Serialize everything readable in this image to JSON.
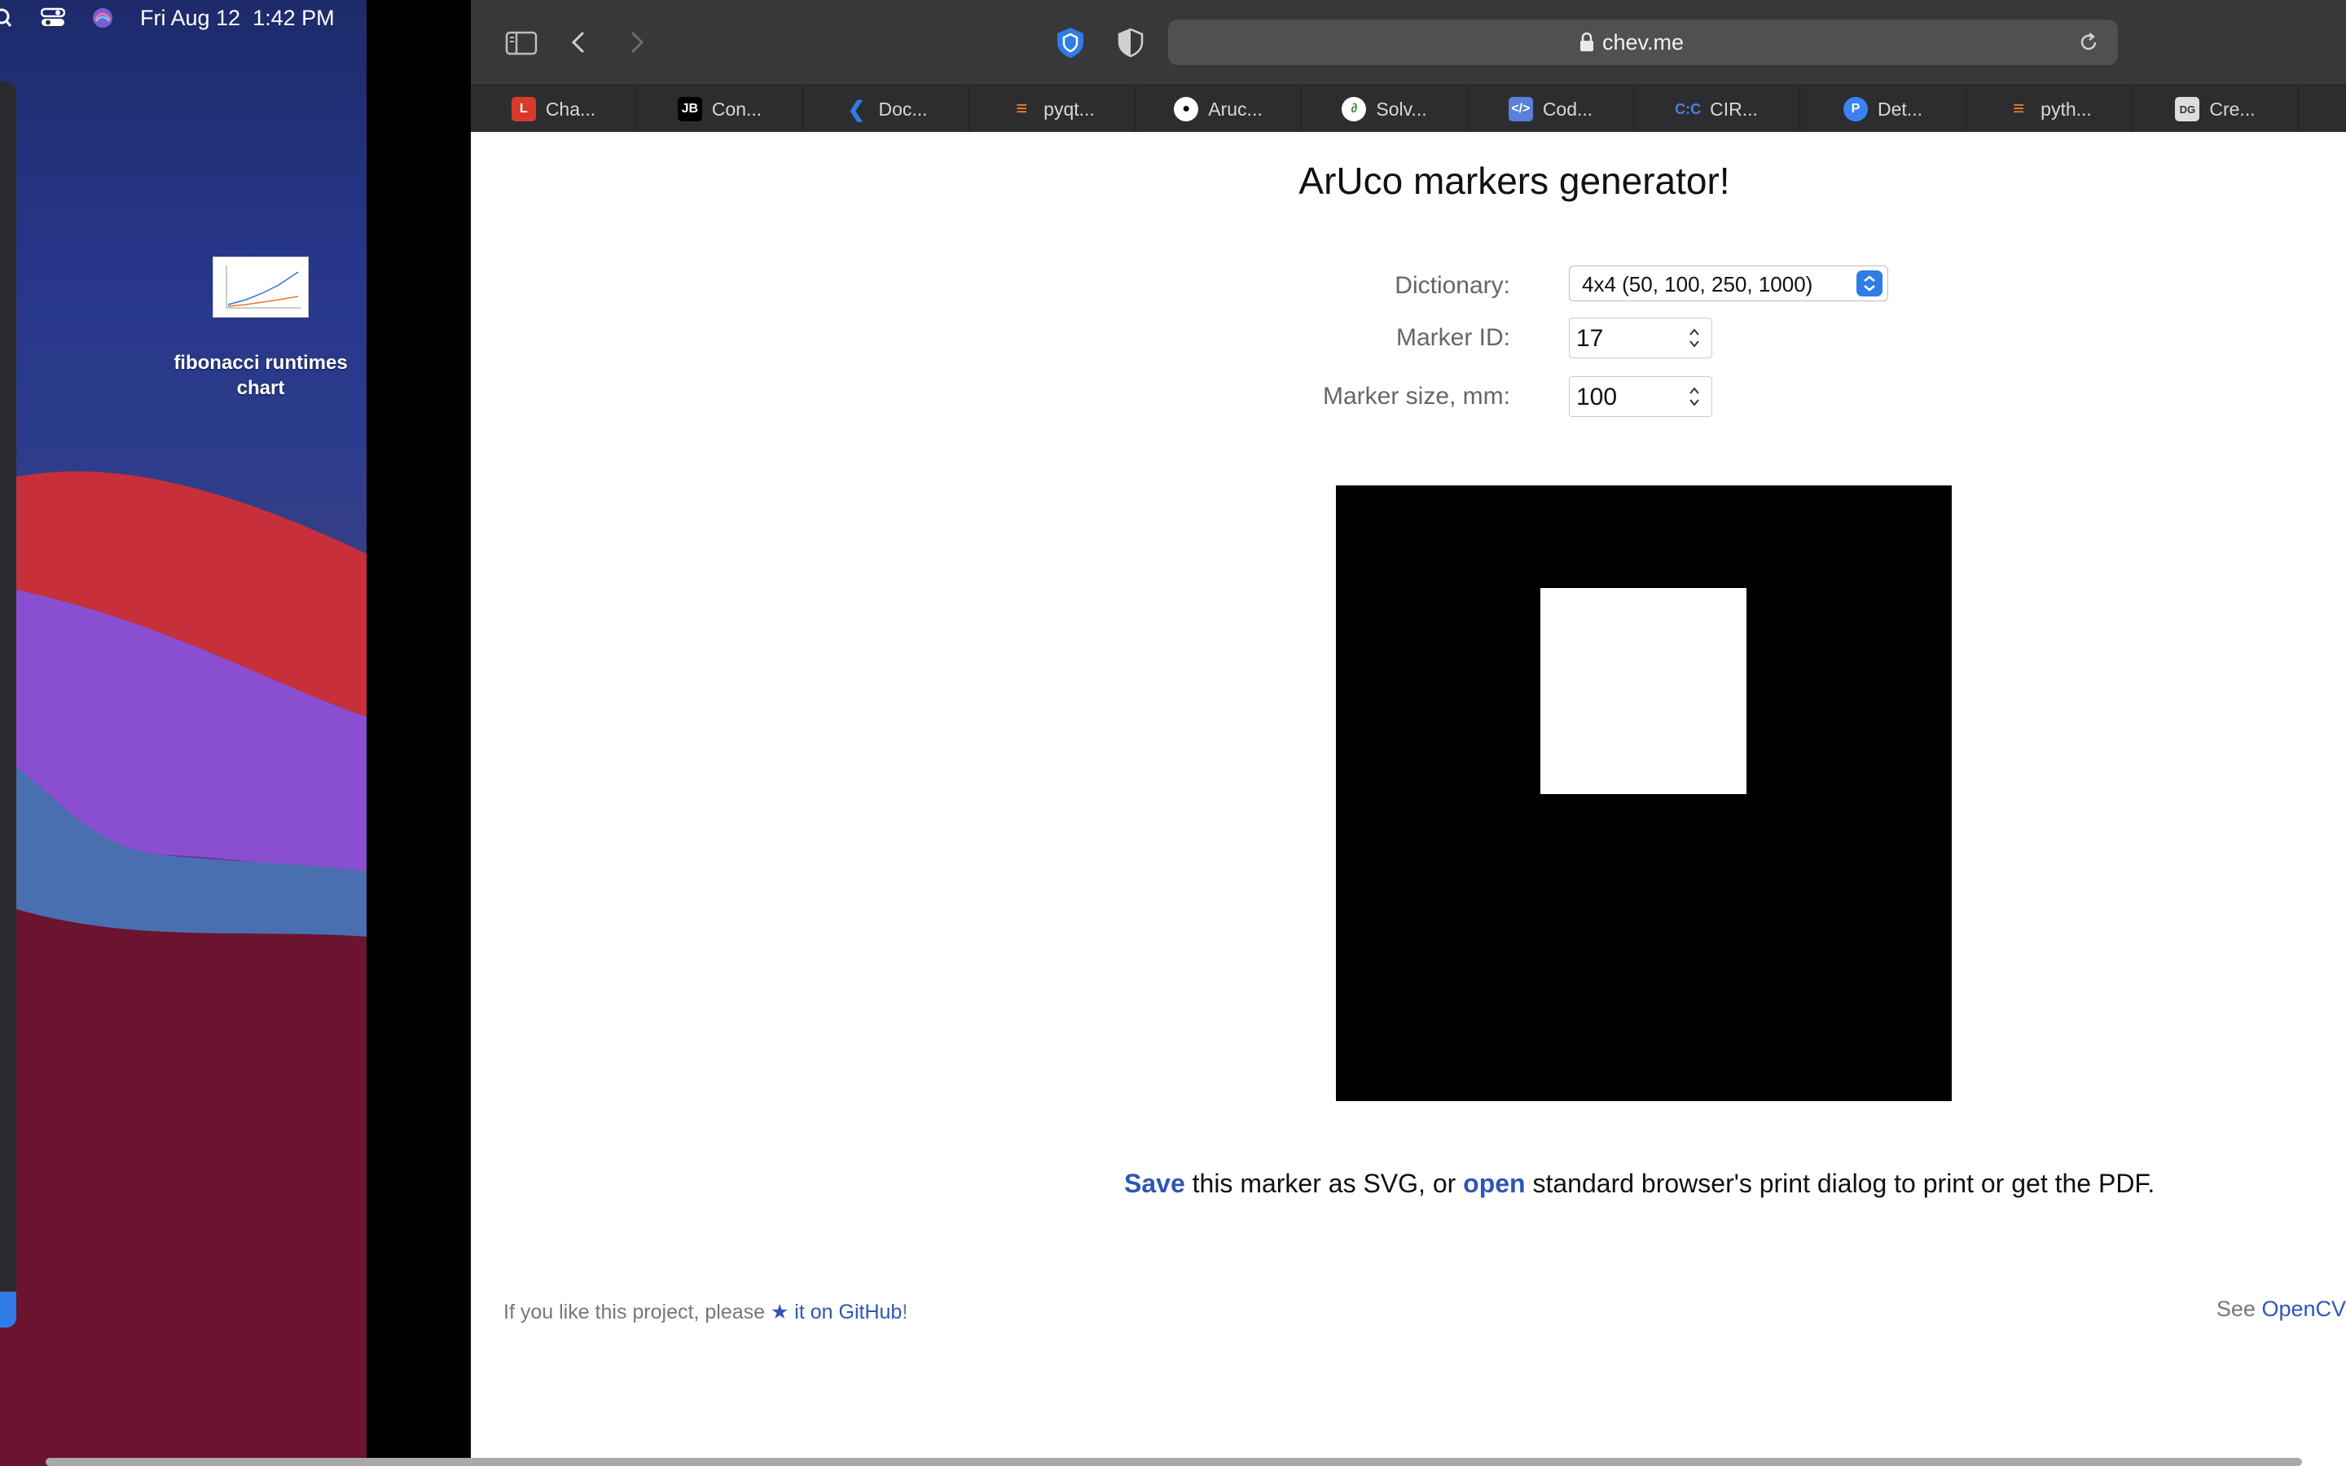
{
  "menubar": {
    "date": "Fri Aug 12",
    "time": "1:42 PM",
    "icons": [
      "search-icon",
      "control-center-icon",
      "siri-icon"
    ]
  },
  "desktop": {
    "file_label_line1": "fibonacci runtimes",
    "file_label_line2": "chart"
  },
  "browser": {
    "url": "chev.me",
    "toolbar_icons": [
      "sidebar-icon",
      "back-icon",
      "forward-icon",
      "shield-blue-icon",
      "shield-half-icon",
      "lock-icon",
      "reload-icon"
    ],
    "favorites": [
      {
        "label": "Cha...",
        "icon": "red-logo",
        "color": "#d93a2b"
      },
      {
        "label": "Con...",
        "icon": "jb-logo",
        "color": "#000000"
      },
      {
        "label": "Doc...",
        "icon": "vscode-logo",
        "color": "#2f7ce6"
      },
      {
        "label": "pyqt...",
        "icon": "stackoverflow-logo",
        "color": "#f48024"
      },
      {
        "label": "Aruc...",
        "icon": "github-logo",
        "color": "#ffffff"
      },
      {
        "label": "Solv...",
        "icon": "solver-logo",
        "color": "#ffffff"
      },
      {
        "label": "Cod...",
        "icon": "code-logo",
        "color": "#5a7fd6"
      },
      {
        "label": "CIR...",
        "icon": "circ-logo",
        "color": "#3b6fd9"
      },
      {
        "label": "Det...",
        "icon": "p-logo",
        "color": "#3b82f6"
      },
      {
        "label": "pyth...",
        "icon": "stackoverflow-logo",
        "color": "#f48024"
      },
      {
        "label": "Cre...",
        "icon": "dg-logo",
        "color": "#dddddd"
      }
    ]
  },
  "page": {
    "title": "ArUco markers generator!",
    "dictionary_label": "Dictionary:",
    "dictionary_value": "4x4 (50, 100, 250, 1000)",
    "marker_id_label": "Marker ID:",
    "marker_id_value": "17",
    "marker_size_label": "Marker size, mm:",
    "marker_size_value": "100",
    "save_link": "Save",
    "save_text_1": " this marker as SVG, or ",
    "open_link": "open",
    "save_text_2": " standard browser's print dialog to print or get the PDF.",
    "footer_left_prefix": "If you like this project, please ",
    "footer_left_link": "★ it on GitHub",
    "footer_left_suffix": "!",
    "footer_right_prefix": "See ",
    "footer_right_link": "OpenCV"
  }
}
